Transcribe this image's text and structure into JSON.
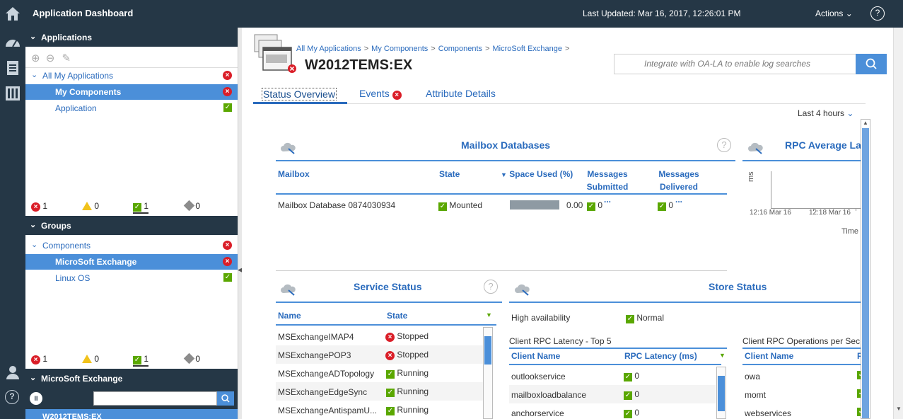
{
  "topbar": {
    "title": "Application Dashboard",
    "last_updated": "Last Updated: Mar 16, 2017, 12:26:01 PM",
    "actions_label": "Actions",
    "help_label": "?"
  },
  "rail": {
    "icons": [
      "home-icon",
      "dashboard-icon",
      "report-icon",
      "performance-icon",
      "user-icon",
      "help-icon"
    ],
    "help_label": "?"
  },
  "applications": {
    "header": "Applications",
    "items": [
      {
        "label": "All My Applications",
        "status": "critical"
      },
      {
        "label": "My Components",
        "status": "critical",
        "selected": true
      },
      {
        "label": "Application",
        "status": "normal"
      }
    ],
    "counts": {
      "critical": "1",
      "warning": "0",
      "normal": "1",
      "unknown": "0"
    }
  },
  "groups": {
    "header": "Groups",
    "items": [
      {
        "label": "Components",
        "status": "critical"
      },
      {
        "label": "MicroSoft Exchange",
        "status": "critical",
        "selected": true
      },
      {
        "label": "Linux OS",
        "status": "normal"
      }
    ],
    "counts": {
      "critical": "1",
      "warning": "0",
      "normal": "1",
      "unknown": "0"
    }
  },
  "instances": {
    "header": "MicroSoft Exchange",
    "filter_placeholder": "",
    "first_item": "W2012TEMS:EX"
  },
  "main": {
    "breadcrumbs": [
      "All My Applications",
      "My Components",
      "Components",
      "MicroSoft Exchange"
    ],
    "breadcrumb_sep": ">",
    "title": "W2012TEMS:EX",
    "search_placeholder": "Integrate with OA-LA to enable log searches",
    "tabs": [
      "Status Overview",
      "Events",
      "Attribute Details"
    ],
    "time_range": "Last 4 hours"
  },
  "mailbox_databases": {
    "title": "Mailbox Databases",
    "columns": [
      "Mailbox",
      "State",
      "Space Used (%)",
      "Messages",
      "Submitted ...",
      "Messages",
      "Delivered ..."
    ],
    "rows": [
      {
        "mailbox": "Mailbox Database 0874030934",
        "state": "Mounted",
        "space_used": "0.00",
        "submitted": "0",
        "delivered": "0"
      }
    ]
  },
  "rpc_latency_chart": {
    "title": "RPC Average Lat",
    "ylabel": "ms",
    "xticks": [
      "12:16 Mar 16",
      "12:18 Mar 16"
    ],
    "xlabel": "Time"
  },
  "service_status": {
    "title": "Service Status",
    "columns": [
      "Name",
      "State"
    ],
    "rows": [
      {
        "name": "MSExchangeIMAP4",
        "state": "Stopped",
        "status": "critical"
      },
      {
        "name": "MSExchangePOP3",
        "state": "Stopped",
        "status": "critical"
      },
      {
        "name": "MSExchangeADTopology",
        "state": "Running",
        "status": "normal"
      },
      {
        "name": "MSExchangeEdgeSync",
        "state": "Running",
        "status": "normal"
      },
      {
        "name": "MSExchangeAntispamU...",
        "state": "Running",
        "status": "normal"
      }
    ]
  },
  "store_status": {
    "title": "Store Status",
    "high_availability_label": "High availability",
    "high_availability_value": "Normal",
    "latency_title": "Client RPC Latency - Top 5",
    "latency_columns": [
      "Client Name",
      "RPC Latency (ms)"
    ],
    "latency_rows": [
      {
        "name": "outlookservice",
        "value": "0"
      },
      {
        "name": "mailboxloadbalance",
        "value": "0"
      },
      {
        "name": "anchorservice",
        "value": "0"
      }
    ],
    "ops_title": "Client RPC Operations per Sec",
    "ops_columns": [
      "Client Name",
      "F"
    ],
    "ops_rows": [
      "owa",
      "momt",
      "webservices"
    ]
  },
  "colors": {
    "nav_bg": "#253746",
    "accent": "#4b8fd9",
    "critical": "#da1e28",
    "normal": "#5aa700",
    "warning": "#f1c21b"
  }
}
